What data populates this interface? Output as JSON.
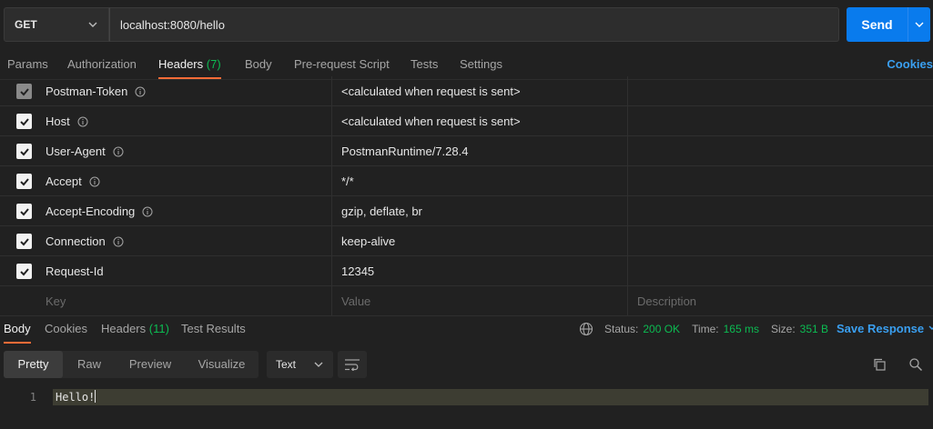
{
  "request": {
    "method": "GET",
    "url": "localhost:8080/hello",
    "send_label": "Send"
  },
  "request_tabs": {
    "params": "Params",
    "authorization": "Authorization",
    "headers": "Headers",
    "headers_count": "(7)",
    "body": "Body",
    "pre_request": "Pre-request Script",
    "tests": "Tests",
    "settings": "Settings",
    "cookies": "Cookies"
  },
  "headers": [
    {
      "key": "Postman-Token",
      "value": "<calculated when request is sent>",
      "info": true
    },
    {
      "key": "Host",
      "value": "<calculated when request is sent>",
      "info": true
    },
    {
      "key": "User-Agent",
      "value": "PostmanRuntime/7.28.4",
      "info": true
    },
    {
      "key": "Accept",
      "value": "*/*",
      "info": true
    },
    {
      "key": "Accept-Encoding",
      "value": "gzip, deflate, br",
      "info": true
    },
    {
      "key": "Connection",
      "value": "keep-alive",
      "info": true
    },
    {
      "key": "Request-Id",
      "value": "12345",
      "info": false
    }
  ],
  "headers_placeholder": {
    "key": "Key",
    "value": "Value",
    "description": "Description"
  },
  "response_tabs": {
    "body": "Body",
    "cookies": "Cookies",
    "headers": "Headers",
    "headers_count": "(11)",
    "test_results": "Test Results"
  },
  "response_status": {
    "status_label": "Status:",
    "status_value": "200 OK",
    "time_label": "Time:",
    "time_value": "165 ms",
    "size_label": "Size:",
    "size_value": "351 B",
    "save_response": "Save Response"
  },
  "view_modes": {
    "pretty": "Pretty",
    "raw": "Raw",
    "preview": "Preview",
    "visualize": "Visualize"
  },
  "format": "Text",
  "response_body": {
    "line_number": "1",
    "text": "Hello!"
  },
  "colors": {
    "accent_blue": "#097bed",
    "tab_underline": "#ff6c37",
    "status_green": "#0cbb52",
    "link_blue": "#3a9ff0"
  }
}
